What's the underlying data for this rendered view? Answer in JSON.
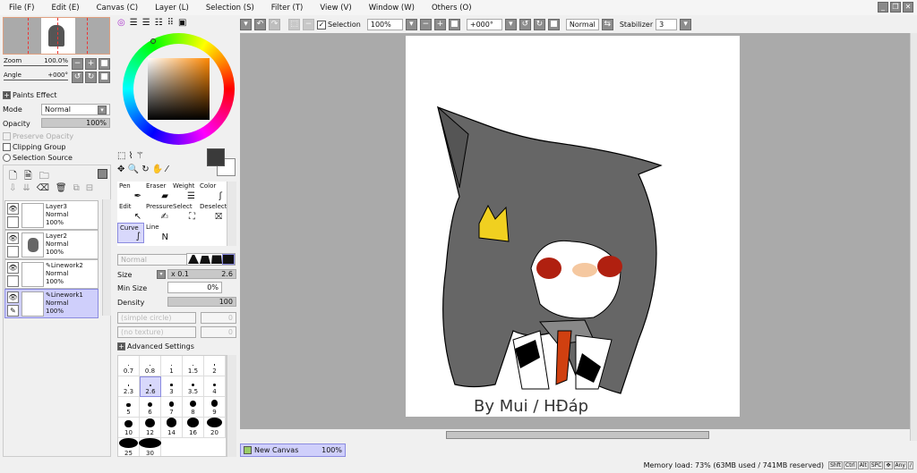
{
  "menu": [
    "File (F)",
    "Edit (E)",
    "Canvas (C)",
    "Layer (L)",
    "Selection (S)",
    "Filter (T)",
    "View (V)",
    "Window (W)",
    "Others (O)"
  ],
  "navigator": {
    "zoom_label": "Zoom",
    "zoom_value": "100.0%",
    "angle_label": "Angle",
    "angle_value": "+000°"
  },
  "paints_effect": {
    "title": "Paints Effect",
    "mode_label": "Mode",
    "mode_value": "Normal",
    "opacity_label": "Opacity",
    "opacity_value": "100%",
    "opacity_fraction": 1.0,
    "preserve_opacity": "Preserve Opacity",
    "clipping_group": "Clipping Group",
    "selection_source": "Selection Source"
  },
  "layers": [
    {
      "name": "Layer3",
      "mode": "Normal",
      "opacity": "100%",
      "selected": false,
      "linework": false
    },
    {
      "name": "Layer2",
      "mode": "Normal",
      "opacity": "100%",
      "selected": false,
      "linework": false
    },
    {
      "name": "Linework2",
      "mode": "Normal",
      "opacity": "100%",
      "selected": false,
      "linework": true
    },
    {
      "name": "Linework1",
      "mode": "Normal",
      "opacity": "100%",
      "selected": true,
      "linework": true
    }
  ],
  "colors": {
    "primary": "#3a3a3a",
    "secondary": "#ffffff",
    "accent": "#8b8be0",
    "selection_bg": "#cfcffb"
  },
  "tools": [
    {
      "label": "Pen",
      "icon": "pen-icon"
    },
    {
      "label": "Eraser",
      "icon": "eraser-icon"
    },
    {
      "label": "Weight",
      "icon": "weight-icon"
    },
    {
      "label": "Color",
      "icon": "color-icon"
    },
    {
      "label": "Edit",
      "icon": "edit-icon"
    },
    {
      "label": "Pressure",
      "icon": "pressure-icon"
    },
    {
      "label": "Select",
      "icon": "select-icon"
    },
    {
      "label": "Deselect",
      "icon": "deselect-icon"
    },
    {
      "label": "Curve",
      "icon": "curve-icon",
      "selected": true
    },
    {
      "label": "Line",
      "icon": "line-icon"
    }
  ],
  "brush": {
    "blend_mode": "Normal",
    "size_label": "Size",
    "size_multiplier": "x 0.1",
    "size_value": "2.6",
    "min_size_label": "Min Size",
    "min_size_value": "0%",
    "density_label": "Density",
    "density_value": "100",
    "shape": "(simple circle)",
    "shape_value": "0",
    "texture": "(no texture)",
    "texture_value": "0",
    "advanced": "Advanced Settings"
  },
  "sizes": [
    "0.7",
    "0.8",
    "1",
    "1.5",
    "2",
    "2.3",
    "2.6",
    "3",
    "3.5",
    "4",
    "5",
    "6",
    "7",
    "8",
    "9",
    "10",
    "12",
    "14",
    "16",
    "20",
    "25",
    "30"
  ],
  "selected_size": "2.6",
  "toolbar": {
    "selection_label": "Selection",
    "selection_checked": true,
    "zoom": "100%",
    "angle": "+000°",
    "blend": "Normal",
    "stabilizer_label": "Stabilizer",
    "stabilizer_value": "3"
  },
  "canvas": {
    "signature": "By Mui / HĐáp"
  },
  "tab": {
    "name": "New Canvas",
    "zoom": "100%"
  },
  "status": {
    "memory": "Memory load: 73% (63MB used / 741MB reserved)",
    "keys": [
      "Shft",
      "Ctrl",
      "Alt",
      "SPC",
      "✥",
      "Any",
      "∕"
    ]
  }
}
